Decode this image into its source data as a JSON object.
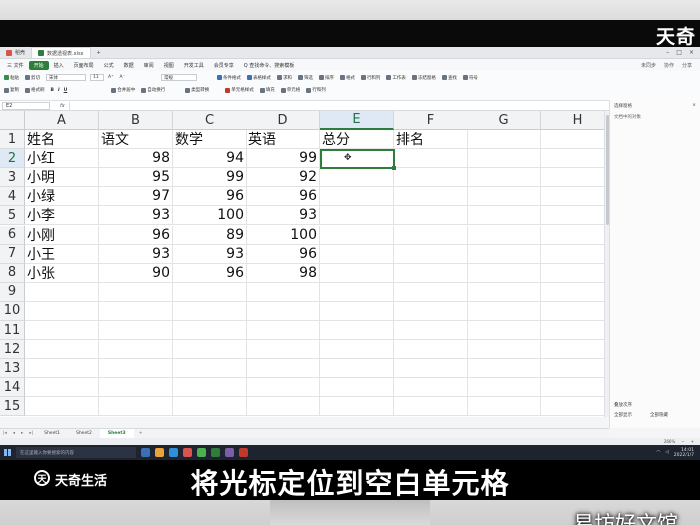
{
  "overlay": {
    "brand_top": "天奇",
    "logo_mark": "天",
    "logo_text": "天奇生活",
    "subtitle": "将光标定位到空白单元格",
    "watermark": "易坊好文馆"
  },
  "window": {
    "tabs": [
      {
        "label": "稻壳"
      },
      {
        "label": "数据透视表.xlsx"
      }
    ],
    "add_tab": "+"
  },
  "menu": {
    "file": "三 文件",
    "items": [
      "开始",
      "插入",
      "页面布局",
      "公式",
      "数据",
      "审阅",
      "视图",
      "开发工具",
      "会员专享"
    ],
    "search": "Q 查找命令、搜索模板",
    "right": [
      "未同步",
      "协作",
      "分享"
    ]
  },
  "ribbon": {
    "row1": [
      "粘贴",
      "剪切",
      "宋体",
      "11",
      "A⁺",
      "A⁻",
      "常规",
      "条件格式",
      "表格样式",
      "求和",
      "筛选",
      "排序",
      "格式",
      "行和列",
      "工作表",
      "冻结窗格",
      "查找",
      "符号"
    ],
    "row2": [
      "复制",
      "格式刷",
      "B",
      "I",
      "U",
      "合并居中",
      "自动换行",
      "类型转换",
      "单元格样式",
      "填充",
      "单元格",
      "行和列"
    ]
  },
  "formula_bar": {
    "cell_ref": "E2",
    "fx": "fx"
  },
  "grid": {
    "columns": [
      "A",
      "B",
      "C",
      "D",
      "E",
      "F",
      "G",
      "H"
    ],
    "selected_column": "E",
    "rows": [
      "1",
      "2",
      "3",
      "4",
      "5",
      "6",
      "7",
      "8",
      "9",
      "10",
      "11",
      "12",
      "13",
      "14",
      "15"
    ],
    "selected_row": "2",
    "header": [
      "姓名",
      "语文",
      "数学",
      "英语",
      "总分",
      "排名"
    ],
    "records": [
      [
        "小红",
        "98",
        "94",
        "99"
      ],
      [
        "小明",
        "95",
        "99",
        "92"
      ],
      [
        "小绿",
        "97",
        "96",
        "96"
      ],
      [
        "小李",
        "93",
        "100",
        "93"
      ],
      [
        "小刚",
        "96",
        "89",
        "100"
      ],
      [
        "小王",
        "93",
        "93",
        "96"
      ],
      [
        "小张",
        "90",
        "96",
        "98"
      ]
    ]
  },
  "side_panel": {
    "title": "选择窗格",
    "subtitle": "文档中的对象",
    "bottom1": "叠放次序",
    "bottom2": [
      "全部显示",
      "全部隐藏"
    ]
  },
  "sheets": {
    "tabs": [
      "Sheet1",
      "Sheet2",
      "Sheet3"
    ],
    "active": "Sheet3",
    "add": "+"
  },
  "status": {
    "zoom": "266%"
  },
  "taskbar": {
    "search_placeholder": "在这里输入你要搜索的内容",
    "time": "14:01",
    "date": "2022/1/7"
  }
}
